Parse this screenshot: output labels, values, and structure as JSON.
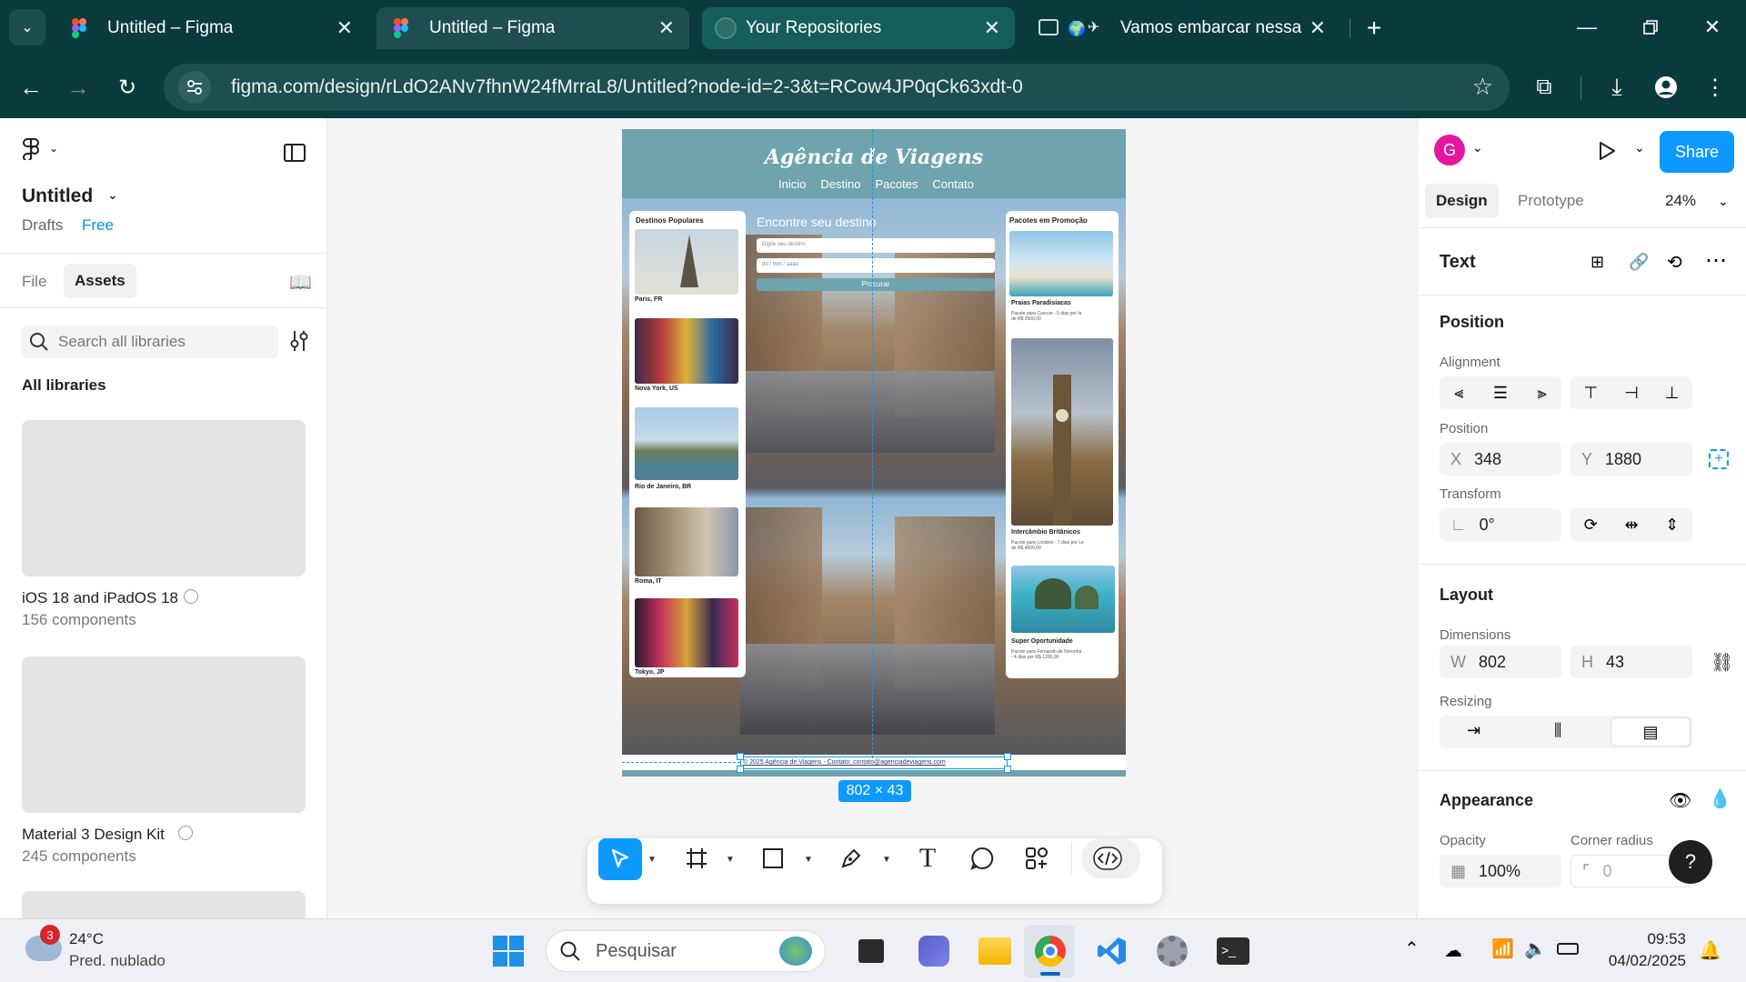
{
  "browser": {
    "tabs": [
      {
        "title": "Untitled – Figma",
        "active": false
      },
      {
        "title": "Untitled – Figma",
        "active": true
      },
      {
        "title": "Your Repositories",
        "active": false
      },
      {
        "title": "Vamos embarcar nessa jo",
        "active": false
      }
    ],
    "url": "figma.com/design/rLdO2ANv7fhnW24fMrraL8/Untitled?node-id=2-3&t=RCow4JP0qCk63xdt-0"
  },
  "left": {
    "file_name": "Untitled",
    "drafts": "Drafts",
    "plan": "Free",
    "tab_file": "File",
    "tab_assets": "Assets",
    "search_placeholder": "Search all libraries",
    "all_libraries": "All libraries",
    "libraries": [
      {
        "name": "iOS 18 and iPadOS 18",
        "count": "156 components"
      },
      {
        "name": "Material 3 Design Kit",
        "count": "245 components"
      }
    ]
  },
  "canvas": {
    "site_title": "Agência de Viagens",
    "nav": [
      "Inicio",
      "Destino",
      "Pacotes",
      "Contato"
    ],
    "left_card_title": "Destinos Populares",
    "destinations": [
      "Paris, FR",
      "Nova York, US",
      "Rio de Janeiro, BR",
      "Roma, IT",
      "Tokyo, JP"
    ],
    "search_heading": "Encontre seu destino",
    "search_placeholder": "Digite seu destino",
    "date_placeholder": "dd / mm / aaaa",
    "search_button": "Procurar",
    "right_card_title": "Pacotes em Promoção",
    "promos": [
      {
        "title": "Praias Paradisíacas",
        "desc": "Pacote para Cancun - 5 dias por la de R$ 2500,00"
      },
      {
        "title": "Intercâmbio Britânicos",
        "desc": "Pacote para Londres - 7 dias por Le de R$ 4000,00"
      },
      {
        "title": "Super Oportunidade",
        "desc": "Pacote para Fernando de Noronha - 4 dias por R$ 1200,00"
      }
    ],
    "footer": "© 2025 Agência de Viagens - Contato: contato@agenciadeviagens.com",
    "size_badge": "802 × 43"
  },
  "right": {
    "avatar_letter": "G",
    "share": "Share",
    "tab_design": "Design",
    "tab_prototype": "Prototype",
    "zoom": "24%",
    "layer_type": "Text",
    "position_title": "Position",
    "alignment_label": "Alignment",
    "position_label": "Position",
    "x_label": "X",
    "x": "348",
    "y_label": "Y",
    "y": "1880",
    "transform_label": "Transform",
    "rotation": "0°",
    "layout_title": "Layout",
    "dimensions_label": "Dimensions",
    "w_label": "W",
    "w": "802",
    "h_label": "H",
    "h": "43",
    "resizing_label": "Resizing",
    "appearance_title": "Appearance",
    "opacity_label": "Opacity",
    "opacity": "100%",
    "corner_label": "Corner radius",
    "corner": "0"
  },
  "taskbar": {
    "badge": "3",
    "temp": "24°C",
    "weather": "Pred. nublado",
    "search": "Pesquisar",
    "time": "09:53",
    "date": "04/02/2025"
  },
  "colors": {
    "chrome": "#0b3a3e",
    "figma_blue": "#0d99ff",
    "site_teal": "#6fa3ae"
  }
}
